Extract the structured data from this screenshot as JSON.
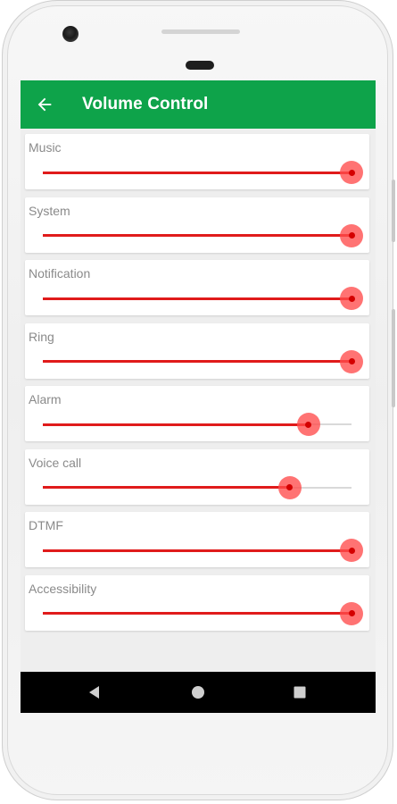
{
  "app": {
    "title": "Volume Control"
  },
  "colors": {
    "appbar": "#0ea34a",
    "accent": "#e01b1b",
    "thumb": "#ff4c4c"
  },
  "icons": {
    "back": "arrow-left-icon",
    "nav_back": "triangle-back-icon",
    "nav_home": "circle-home-icon",
    "nav_recents": "square-recents-icon"
  },
  "volumes": [
    {
      "label": "Music",
      "level": 1.0
    },
    {
      "label": "System",
      "level": 1.0
    },
    {
      "label": "Notification",
      "level": 1.0
    },
    {
      "label": "Ring",
      "level": 1.0
    },
    {
      "label": "Alarm",
      "level": 0.86
    },
    {
      "label": "Voice call",
      "level": 0.8
    },
    {
      "label": "DTMF",
      "level": 1.0
    },
    {
      "label": "Accessibility",
      "level": 1.0
    }
  ]
}
